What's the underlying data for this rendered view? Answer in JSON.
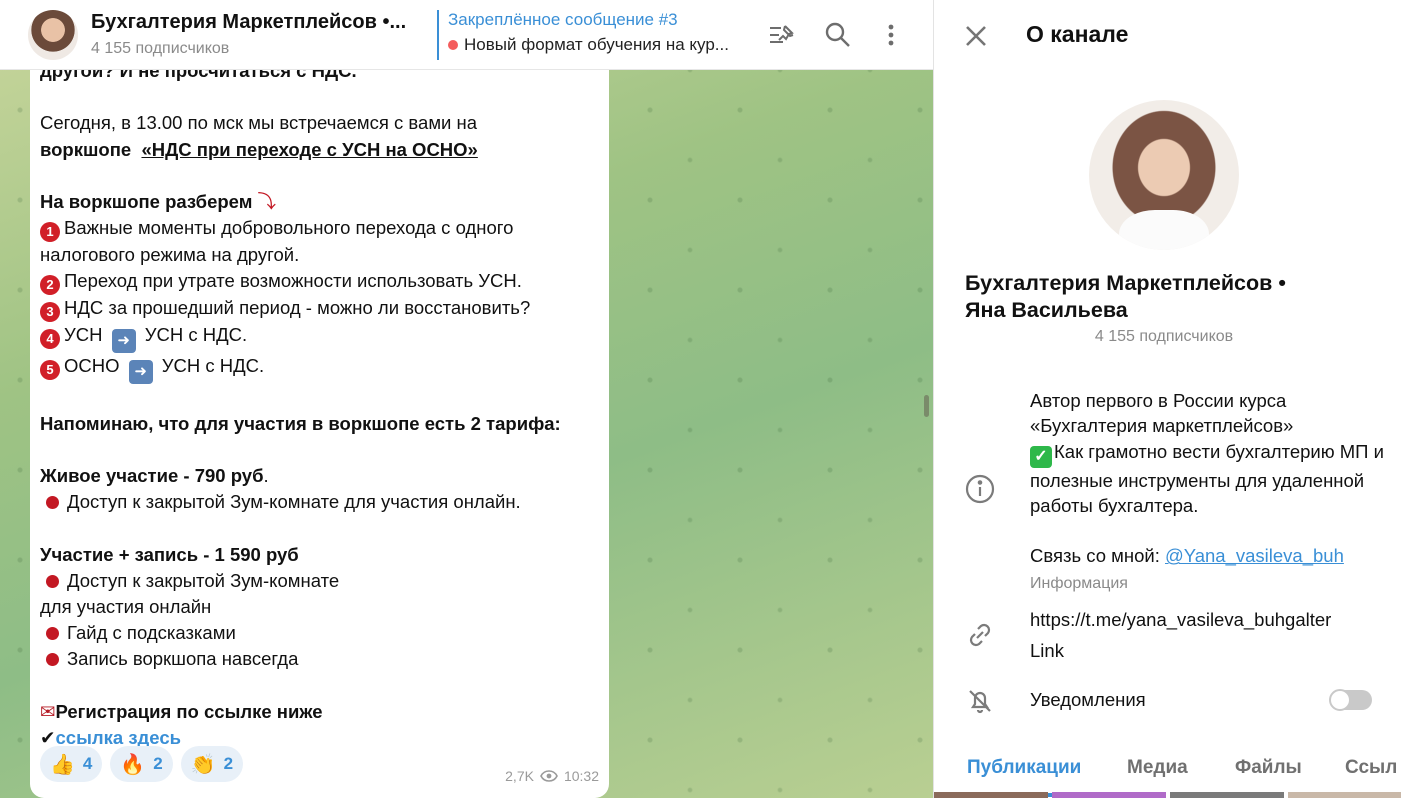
{
  "header": {
    "title": "Бухгалтерия Маркетплейсов •...",
    "subscribers": "4 155 подписчиков",
    "pinned_title": "Закреплённое сообщение #3",
    "pinned_text": "Новый формат обучения на кур..."
  },
  "message": {
    "line_top": "другой? И не просчитаться с НДС.",
    "today_1": "Сегодня, в 13.00 по мск мы встречаемся с вами на",
    "today_2_bold": "воркшопе",
    "today_2_link": "«НДС при переходе с УСН на ОСНО»",
    "will_cover": "На воркшопе разберем",
    "item1": "Важные моменты добровольного перехода с одного налогового режима на другой.",
    "item2": "Переход при утрате возможности использовать УСН.",
    "item3": "НДС за прошедший период - можно ли восстановить?",
    "item4a": "УСН",
    "item4b": "УСН с НДС.",
    "item5a": "ОСНО",
    "item5b": "УСН с НДС.",
    "reminder": "Напоминаю, что для участия в воркшопе есть 2 тарифа:",
    "live_title": "Живое участие - 790 руб",
    "live_dot": ".",
    "live_item": "Доступ к закрытой Зум-комнате для участия онлайн.",
    "rec_title": "Участие + запись - 1 590 руб",
    "rec_item1a": "Доступ к закрытой Зум-комнате",
    "rec_item1b": "для участия онлайн",
    "rec_item2": "Гайд с подсказками",
    "rec_item3": "Запись воркшопа навсегда",
    "register": "Регистрация по ссылке ниже",
    "link_text": "ссылка здесь",
    "reactions": [
      {
        "emoji": "👍",
        "count": "4"
      },
      {
        "emoji": "🔥",
        "count": "2"
      },
      {
        "emoji": "👏",
        "count": "2"
      }
    ],
    "views": "2,7K",
    "time": "10:32"
  },
  "panel": {
    "title": "О канале",
    "name_line1": "Бухгалтерия Маркетплейсов •",
    "name_line2": "Яна Васильева",
    "subscribers": "4 155 подписчиков",
    "desc_1": "Автор первого в России курса «Бухгалтерия маркетплейсов»",
    "desc_2": "Как грамотно вести бухгалтерию МП и полезные инструменты для удаленной работы бухгалтера.",
    "contact_label": "Связь со мной: ",
    "contact_handle": "@Yana_vasileva_buh",
    "info_caption": "Информация",
    "link_url": "https://t.me/yana_vasileva_buhgalter",
    "link_caption": "Link",
    "notifications": "Уведомления",
    "tabs": [
      "Публикации",
      "Медиа",
      "Файлы",
      "Ссыл"
    ]
  },
  "colors": {
    "accent": "#3a8fd6",
    "red_bullet": "#c31823",
    "check": "#2eb84a"
  }
}
